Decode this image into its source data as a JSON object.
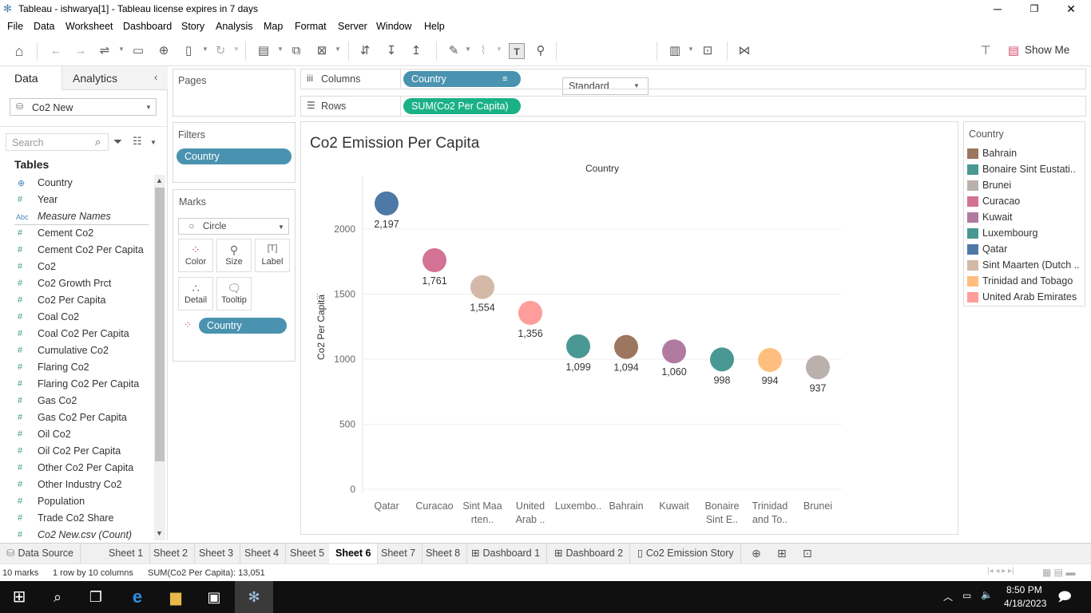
{
  "window": {
    "title": "Tableau - ishwarya[1] - Tableau license expires in 7 days"
  },
  "menu": [
    "File",
    "Data",
    "Worksheet",
    "Dashboard",
    "Story",
    "Analysis",
    "Map",
    "Format",
    "Server",
    "Window",
    "Help"
  ],
  "toolbar": {
    "fit": "Standard",
    "show_me": "Show Me"
  },
  "data_pane": {
    "tab_data": "Data",
    "tab_analytics": "Analytics",
    "datasource": "Co2 New",
    "search_placeholder": "Search",
    "tables_header": "Tables",
    "fields": [
      {
        "icon": "globe-icon",
        "name": "Country",
        "italic": false
      },
      {
        "icon": "calendar-hash-icon",
        "name": "Year",
        "italic": false
      },
      {
        "icon": "abc-icon",
        "name": "Measure Names",
        "italic": true
      },
      {
        "icon": "hash-icon",
        "name": "Cement Co2",
        "italic": false
      },
      {
        "icon": "hash-icon",
        "name": "Cement Co2 Per Capita",
        "italic": false
      },
      {
        "icon": "hash-icon",
        "name": "Co2",
        "italic": false
      },
      {
        "icon": "hash-icon",
        "name": "Co2 Growth Prct",
        "italic": false
      },
      {
        "icon": "hash-icon",
        "name": "Co2 Per Capita",
        "italic": false
      },
      {
        "icon": "hash-icon",
        "name": "Coal Co2",
        "italic": false
      },
      {
        "icon": "hash-icon",
        "name": "Coal Co2 Per Capita",
        "italic": false
      },
      {
        "icon": "hash-icon",
        "name": "Cumulative Co2",
        "italic": false
      },
      {
        "icon": "hash-icon",
        "name": "Flaring Co2",
        "italic": false
      },
      {
        "icon": "hash-icon",
        "name": "Flaring Co2 Per Capita",
        "italic": false
      },
      {
        "icon": "hash-icon",
        "name": "Gas Co2",
        "italic": false
      },
      {
        "icon": "hash-icon",
        "name": "Gas Co2 Per Capita",
        "italic": false
      },
      {
        "icon": "hash-icon",
        "name": "Oil Co2",
        "italic": false
      },
      {
        "icon": "hash-icon",
        "name": "Oil Co2 Per Capita",
        "italic": false
      },
      {
        "icon": "hash-icon",
        "name": "Other Co2 Per Capita",
        "italic": false
      },
      {
        "icon": "hash-icon",
        "name": "Other Industry Co2",
        "italic": false
      },
      {
        "icon": "hash-icon",
        "name": "Population",
        "italic": false
      },
      {
        "icon": "hash-icon",
        "name": "Trade Co2 Share",
        "italic": false
      },
      {
        "icon": "hash-icon",
        "name": "Co2 New.csv (Count)",
        "italic": true
      }
    ]
  },
  "shelves": {
    "pages": "Pages",
    "filters": "Filters",
    "filter_pill": "Country",
    "marks": "Marks",
    "mark_type": "Circle",
    "mark_buttons": [
      "Color",
      "Size",
      "Label",
      "Detail",
      "Tooltip"
    ],
    "marks_pill": "Country",
    "columns_label": "Columns",
    "columns_pill": "Country",
    "rows_label": "Rows",
    "rows_pill": "SUM(Co2 Per Capita)"
  },
  "chart_data": {
    "type": "scatter",
    "title": "Co2 Emission Per Capita",
    "xlabel": "Country",
    "ylabel": "Co2 Per Capita",
    "ylim": [
      0,
      2300
    ],
    "yticks": [
      0,
      500,
      1000,
      1500,
      2000
    ],
    "grid": true,
    "categories": [
      "Qatar",
      "Curacao",
      "Sint Maarten (Dutch part)",
      "United Arab Emirates",
      "Luxembourg",
      "Bahrain",
      "Kuwait",
      "Bonaire Sint Eustatius and Saba",
      "Trinidad and Tobago",
      "Brunei"
    ],
    "category_labels": [
      [
        "Qatar"
      ],
      [
        "Curacao"
      ],
      [
        "Sint Maa",
        "rten.."
      ],
      [
        "United",
        "Arab .."
      ],
      [
        "Luxembo.."
      ],
      [
        "Bahrain"
      ],
      [
        "Kuwait"
      ],
      [
        "Bonaire",
        "Sint E.."
      ],
      [
        "Trinidad",
        "and To.."
      ],
      [
        "Brunei"
      ]
    ],
    "values": [
      2197,
      1761,
      1554,
      1356,
      1099,
      1094,
      1060,
      998,
      994,
      937
    ],
    "value_labels": [
      "2,197",
      "1,761",
      "1,554",
      "1,356",
      "1,099",
      "1,094",
      "1,060",
      "998",
      "994",
      "937"
    ],
    "colors": [
      "#4e79a7",
      "#d37295",
      "#d4b9a8",
      "#ff9d9a",
      "#499894",
      "#9d7660",
      "#b07aa1",
      "#499894",
      "#ffbe7d",
      "#bab0ac"
    ]
  },
  "legend": {
    "title": "Country",
    "items": [
      {
        "label": "Bahrain",
        "color": "#9d7660"
      },
      {
        "label": "Bonaire Sint Eustati..",
        "color": "#499894"
      },
      {
        "label": "Brunei",
        "color": "#bab0ac"
      },
      {
        "label": "Curacao",
        "color": "#d37295"
      },
      {
        "label": "Kuwait",
        "color": "#b07aa1"
      },
      {
        "label": "Luxembourg",
        "color": "#499894"
      },
      {
        "label": "Qatar",
        "color": "#4e79a7"
      },
      {
        "label": "Sint Maarten (Dutch ..",
        "color": "#d4b9a8"
      },
      {
        "label": "Trinidad and Tobago",
        "color": "#ffbe7d"
      },
      {
        "label": "United Arab Emirates",
        "color": "#ff9d9a"
      }
    ]
  },
  "tabs": [
    "Data Source",
    "Sheet 1",
    "Sheet 2",
    "Sheet 3",
    "Sheet 4",
    "Sheet 5",
    "Sheet 6",
    "Sheet 7",
    "Sheet 8",
    "Dashboard 1",
    "Dashboard 2",
    "Co2 Emission Story"
  ],
  "active_tab": "Sheet 6",
  "status": {
    "marks": "10 marks",
    "dims": "1 row by 10 columns",
    "sum": "SUM(Co2 Per Capita): 13,051"
  },
  "taskbar": {
    "time": "8:50 PM",
    "date": "4/18/2023"
  }
}
